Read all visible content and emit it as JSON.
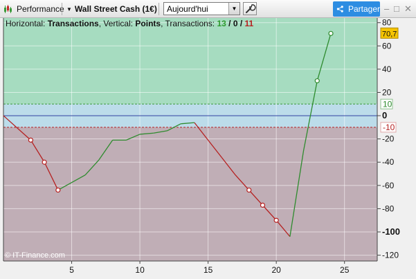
{
  "toolbar": {
    "performance_label": "Performance",
    "instrument": "Wall Street Cash (1€)",
    "period_value": "Aujourd'hui",
    "share_label": "Partager"
  },
  "legend": {
    "horizontal_label": "Horizontal: ",
    "horizontal_value": "Transactions",
    "vertical_label": ", Vertical: ",
    "vertical_value": "Points",
    "transactions_label": ", Transactions: ",
    "count_green": "13",
    "slash1": " / ",
    "count_zero": "0",
    "slash2": " / ",
    "count_red": "11"
  },
  "credit": "© IT-Finance.com",
  "colors": {
    "gain": "#2e8b2e",
    "loss": "#b52020",
    "upper_zone": "#a6dcc0",
    "band": "#bcdcea",
    "lower_zone": "#c0aeb6"
  },
  "chart_data": {
    "type": "line",
    "x": [
      0,
      2,
      3,
      4,
      6,
      7,
      8,
      9,
      10,
      11,
      12,
      13,
      14,
      15,
      16,
      17,
      18,
      19,
      20,
      21,
      22,
      23,
      24
    ],
    "series": [
      {
        "values": [
          0,
          -21,
          -40,
          -64,
          -51,
          -38,
          -21,
          -21,
          -16,
          -15,
          -13,
          -7,
          -6,
          -21,
          -36,
          -51,
          -64,
          -77,
          -90,
          -104,
          -30,
          30,
          70.7
        ],
        "markers_at": [
          2,
          3,
          4,
          18,
          19,
          20,
          23,
          24
        ]
      }
    ],
    "x_range": [
      0,
      27.4
    ],
    "x_ticks": [
      "5",
      "10",
      "15",
      "20",
      "25"
    ],
    "ylim": [
      -125,
      84
    ],
    "y_ticks": [
      "80",
      "60",
      "40",
      "20",
      "0",
      "-20",
      "-40",
      "-60",
      "-80",
      "-100",
      "-120"
    ],
    "bold_ticks": [
      "0",
      "-100"
    ],
    "band": {
      "upper": 10,
      "lower": -10,
      "upper_label": "10",
      "lower_label": "-10"
    },
    "last_value_label": "70,7",
    "grid": true
  }
}
